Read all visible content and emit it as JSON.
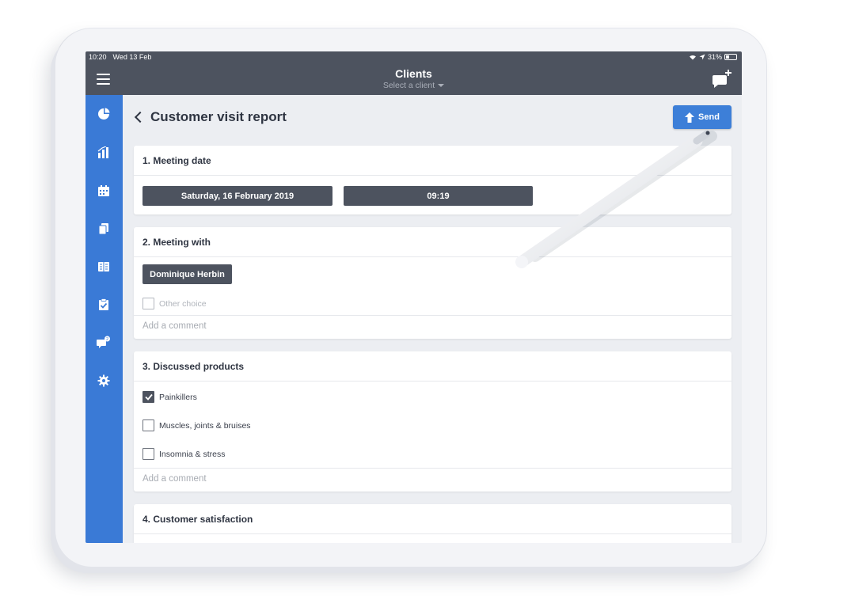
{
  "status": {
    "time": "10:20",
    "date": "Wed 13 Feb",
    "battery": "31%"
  },
  "nav": {
    "title": "Clients",
    "subtitle": "Select a client"
  },
  "sidebar": {
    "items": [
      {
        "icon": "pie-chart-icon"
      },
      {
        "icon": "bar-chart-icon"
      },
      {
        "icon": "calendar-icon"
      },
      {
        "icon": "documents-icon"
      },
      {
        "icon": "book-icon"
      },
      {
        "icon": "clipboard-check-icon"
      },
      {
        "icon": "chat-notification-icon"
      },
      {
        "icon": "gear-icon"
      }
    ],
    "accent": "#3a7ad6"
  },
  "page": {
    "title": "Customer visit report",
    "send_label": "Send"
  },
  "sections": [
    {
      "title": "1. Meeting date",
      "date": "Saturday, 16 February 2019",
      "time": "09:19"
    },
    {
      "title": "2. Meeting with",
      "selected_chip": "Dominique Herbin",
      "other_choice": "Other choice",
      "comment_placeholder": "Add a comment"
    },
    {
      "title": "3. Discussed products",
      "options": [
        {
          "label": "Painkillers",
          "checked": true
        },
        {
          "label": "Muscles, joints & bruises",
          "checked": false
        },
        {
          "label": "Insomnia & stress",
          "checked": false
        }
      ],
      "comment_placeholder": "Add a comment"
    },
    {
      "title": "4. Customer satisfaction"
    }
  ],
  "colors": {
    "nav_bg": "#4d535f",
    "send_bg": "#3d7fd8"
  }
}
